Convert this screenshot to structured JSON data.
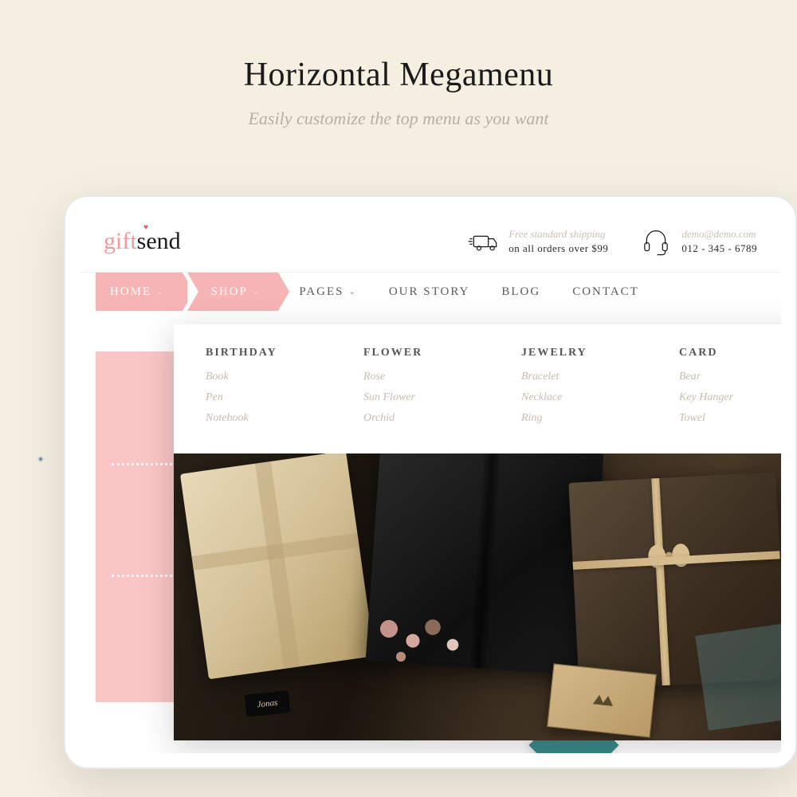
{
  "page": {
    "title": "Horizontal Megamenu",
    "subtitle": "Easily customize the top menu as you want"
  },
  "logo": {
    "part1": "gift",
    "part2": "send"
  },
  "shipping": {
    "line1": "Free standard shipping",
    "line2": "on all orders over $99"
  },
  "contact": {
    "email": "demo@demo.com",
    "phone": "012 - 345 - 6789"
  },
  "nav": {
    "home": "HOME",
    "shop": "SHOP",
    "pages": "PAGES",
    "story": "OUR STORY",
    "blog": "BLOG",
    "contact": "CONTACT"
  },
  "mega": {
    "cols": [
      {
        "title": "BIRTHDAY",
        "items": [
          "Book",
          "Pen",
          "Notebook"
        ]
      },
      {
        "title": "FLOWER",
        "items": [
          "Rose",
          "Sun Flower",
          "Orchid"
        ]
      },
      {
        "title": "JEWELRY",
        "items": [
          "Bracelet",
          "Necklace",
          "Ring"
        ]
      },
      {
        "title": "CARD",
        "items": [
          "Bear",
          "Key Hanger",
          "Towel"
        ]
      }
    ]
  },
  "tag": "Jonas"
}
